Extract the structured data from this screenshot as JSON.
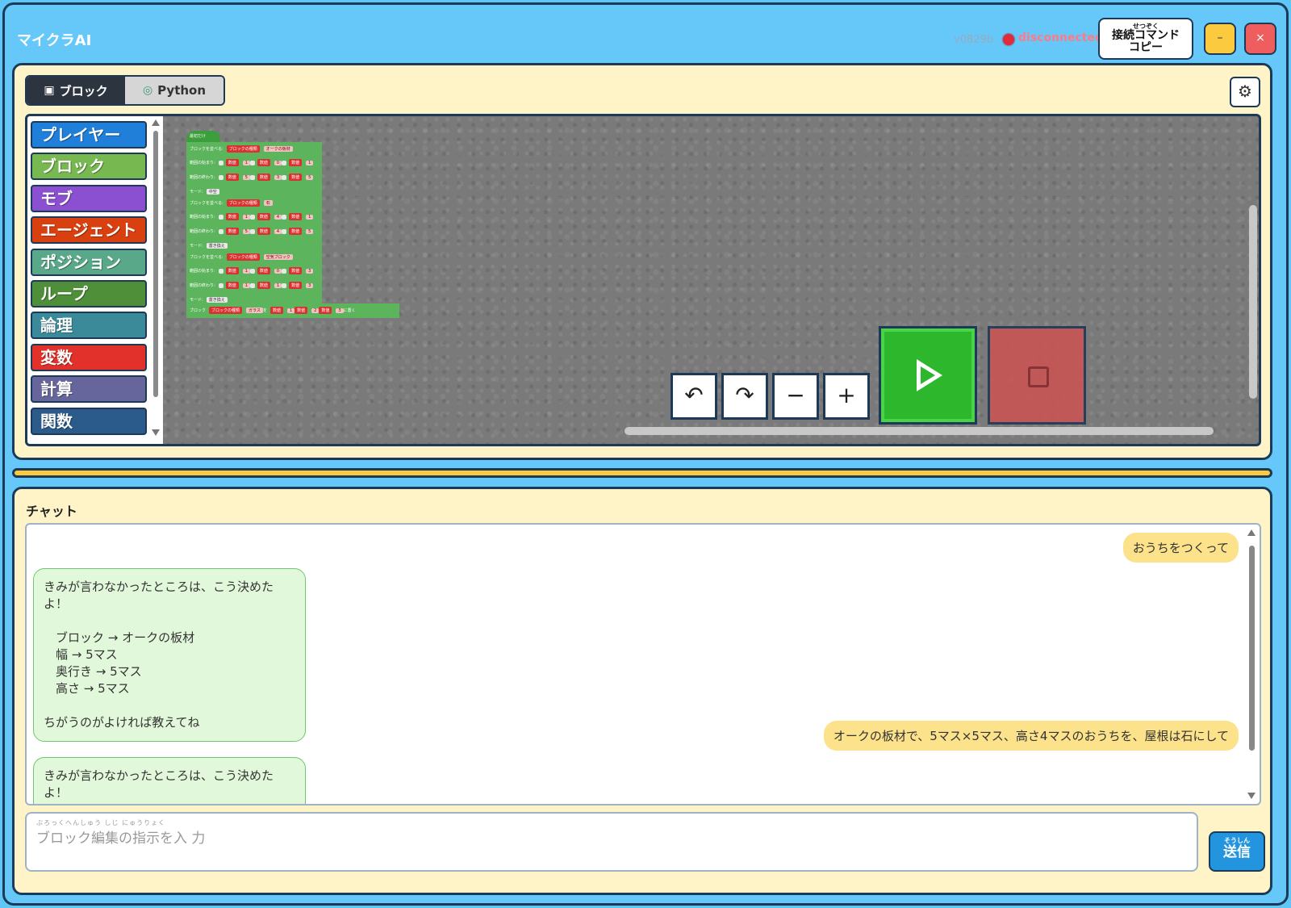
{
  "app": {
    "title": "マイクラAI",
    "version": "v0829b",
    "status": "disconnected",
    "status_color": "#e02b3a",
    "copy_button": {
      "ruby": "せつぞく",
      "line1": "接続コマンド",
      "line2": "コピー"
    },
    "minimize_label": "–",
    "close_label": "×"
  },
  "editor": {
    "tabs": [
      {
        "label": "ブロック",
        "icon": "cube-icon",
        "glyph": "▣",
        "active": true
      },
      {
        "label": "Python",
        "icon": "python-icon",
        "glyph": "◎",
        "active": false
      }
    ],
    "settings_glyph": "⚙",
    "categories": [
      {
        "label": "プレイヤー",
        "color": "#1f7fd9"
      },
      {
        "label": "ブロック",
        "color": "#77b851"
      },
      {
        "label": "モブ",
        "color": "#8b4fd1"
      },
      {
        "label": "エージェント",
        "color": "#d9400f"
      },
      {
        "label": "ポジション",
        "color": "#5aa88a"
      },
      {
        "label": "ループ",
        "color": "#4f8f3a"
      },
      {
        "label": "論理",
        "color": "#3b8a99"
      },
      {
        "label": "変数",
        "color": "#e2302a"
      },
      {
        "label": "計算",
        "color": "#66669c"
      },
      {
        "label": "関数",
        "color": "#2a5b8a"
      }
    ],
    "program": {
      "hat": "最初だけ",
      "fill_label": "ブロックを並べる:",
      "from_label": "範囲の始まり:",
      "to_label": "範囲の終わり:",
      "mode_label": "モード:",
      "kind_label": "ブロックの種類",
      "num_label": "数値",
      "fills": [
        {
          "block": "オークの板材",
          "from": [
            "1",
            "0",
            "1"
          ],
          "to": [
            "5",
            "3",
            "5"
          ],
          "mode": "中空"
        },
        {
          "block": "石",
          "from": [
            "1",
            "4",
            "1"
          ],
          "to": [
            "5",
            "4",
            "5"
          ],
          "mode": "置き換え"
        },
        {
          "block": "空気ブロック",
          "from": [
            "1",
            "0",
            "3"
          ],
          "to": [
            "1",
            "1",
            "3"
          ],
          "mode": "置き換え"
        }
      ],
      "place": {
        "label": "ブロック",
        "block": "ガラス",
        "wo": "を",
        "nums": [
          "1",
          "2",
          "3"
        ],
        "suffix": "に置く"
      }
    },
    "controls": {
      "undo": "↶",
      "redo": "↷",
      "zoom_out": "−",
      "zoom_in": "+"
    }
  },
  "chat": {
    "title": "チャット",
    "messages": [
      {
        "role": "user",
        "text": "おうちをつくって"
      },
      {
        "role": "ai",
        "intro": "きみが言わなかったところは、こう決めたよ！",
        "lines": [
          "ブロック → オークの板材",
          "幅 → 5マス",
          "奥行き → 5マス",
          "高さ → 5マス"
        ],
        "outro": "ちがうのがよければ教えてね"
      },
      {
        "role": "user",
        "text": "オークの板材で、5マス×5マス、高さ4マスのおうちを、屋根は石にして"
      },
      {
        "role": "ai",
        "intro": "きみが言わなかったところは、こう決めたよ！"
      }
    ],
    "input": {
      "ruby": "ぶろっくへんしゅう しじ にゅうりょく",
      "placeholder": "ブロック編集の指示を入 力"
    },
    "send": {
      "ruby": "そうしん",
      "label": "送信"
    }
  }
}
